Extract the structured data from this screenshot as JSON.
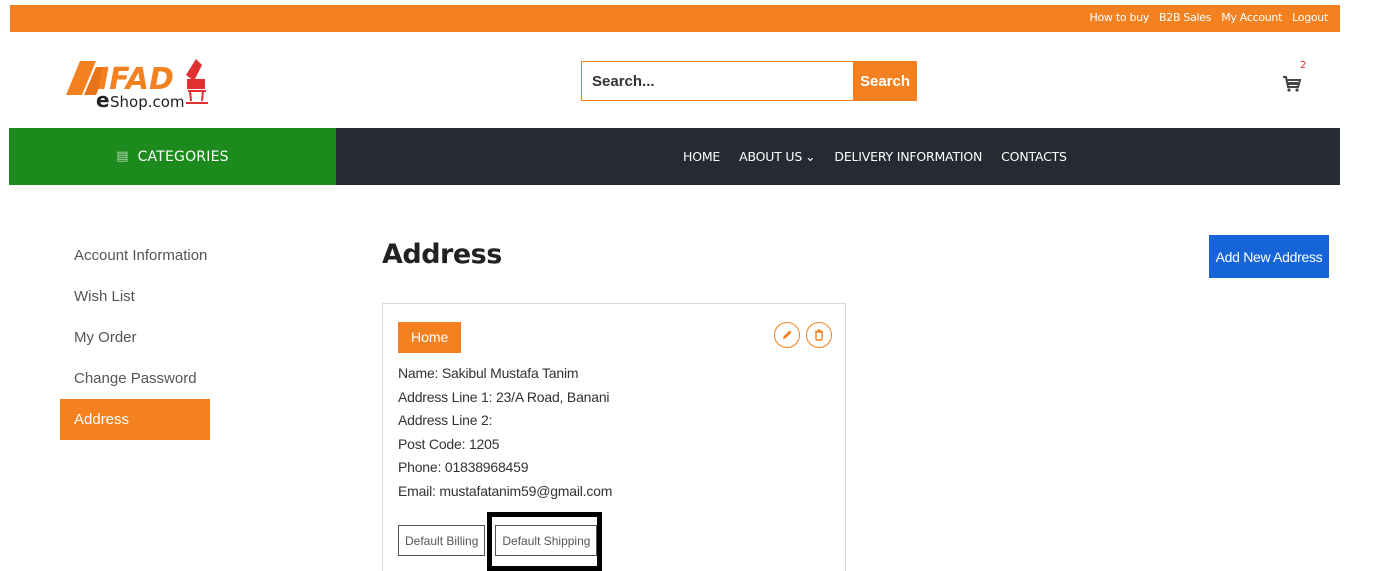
{
  "top_links": [
    "How to buy",
    "B2B Sales",
    "My Account",
    "Logout"
  ],
  "logo": {
    "text": "IFAD",
    "sub": "eShop.com"
  },
  "search": {
    "placeholder": "Search...",
    "button": "Search"
  },
  "cart": {
    "count": "2"
  },
  "nav": {
    "categories_label": "CATEGORIES",
    "items": [
      "HOME",
      "ABOUT US",
      "DELIVERY INFORMATION",
      "CONTACTS"
    ]
  },
  "sidebar": {
    "items": [
      {
        "label": "Account Information",
        "active": false
      },
      {
        "label": "Wish List",
        "active": false
      },
      {
        "label": "My Order",
        "active": false
      },
      {
        "label": "Change Password",
        "active": false
      },
      {
        "label": "Address",
        "active": true
      }
    ]
  },
  "main": {
    "title": "Address",
    "add_button": "Add New Address"
  },
  "address_card": {
    "tag": "Home",
    "lines": [
      "Name: Sakibul Mustafa Tanim",
      "Address Line 1: 23/A Road, Banani",
      "Address Line 2:",
      "Post Code: 1205",
      "Phone: 01838968459",
      "Email: mustafatanim59@gmail.com"
    ],
    "default_billing": "Default Billing",
    "default_shipping": "Default Shipping"
  },
  "colors": {
    "accent_orange": "#f48120",
    "nav_dark": "#262a33",
    "categories_green": "#1c8a1c",
    "primary_blue": "#1565d8"
  }
}
